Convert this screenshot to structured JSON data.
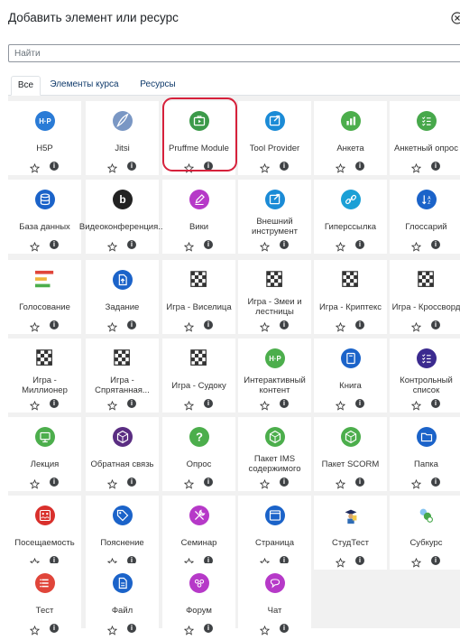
{
  "dialog": {
    "title": "Добавить элемент или ресурс",
    "search_placeholder": "Найти"
  },
  "tabs": [
    {
      "label": "Все",
      "active": true
    },
    {
      "label": "Элементы курса",
      "active": false
    },
    {
      "label": "Ресурсы",
      "active": false
    }
  ],
  "modules": [
    {
      "name": "H5P",
      "icon": "h5p-icon",
      "color": "#2a7bd6"
    },
    {
      "name": "Jitsi",
      "icon": "feather-icon",
      "color": "#7a97c4"
    },
    {
      "name": "Pruffme Module",
      "icon": "briefcase-play-icon",
      "color": "#3c9a4a",
      "highlighted": true
    },
    {
      "name": "Tool Provider",
      "icon": "external-tool-icon",
      "color": "#1b8bd6"
    },
    {
      "name": "Анкета",
      "icon": "chart-icon",
      "color": "#4cae4c"
    },
    {
      "name": "Анкетный опрос",
      "icon": "checklist-icon",
      "color": "#47a84b"
    },
    {
      "name": "База данных",
      "icon": "database-icon",
      "color": "#1b63c9"
    },
    {
      "name": "Видеоконференция...",
      "icon": "b-logo-icon",
      "color": "#222222"
    },
    {
      "name": "Вики",
      "icon": "pencil-icon",
      "color": "#b639c8"
    },
    {
      "name": "Внешний инструмент",
      "icon": "external-tool-icon",
      "color": "#1b8bd6"
    },
    {
      "name": "Гиперссылка",
      "icon": "link-icon",
      "color": "#1ba0d6"
    },
    {
      "name": "Глоссарий",
      "icon": "sort-icon",
      "color": "#1b63c9"
    },
    {
      "name": "Голосование",
      "icon": "bars-icon",
      "color": "#e0453a"
    },
    {
      "name": "Задание",
      "icon": "upload-icon",
      "color": "#1b63c9"
    },
    {
      "name": "Игра - Виселица",
      "icon": "checker-icon",
      "color": "#333333"
    },
    {
      "name": "Игра - Змеи и лестницы",
      "icon": "checker-icon",
      "color": "#333333"
    },
    {
      "name": "Игра - Криптекс",
      "icon": "checker-icon",
      "color": "#333333"
    },
    {
      "name": "Игра - Кроссворд",
      "icon": "checker-icon",
      "color": "#333333"
    },
    {
      "name": "Игра - Миллионер",
      "icon": "checker-icon",
      "color": "#333333"
    },
    {
      "name": "Игра - Спрятанная...",
      "icon": "checker-icon",
      "color": "#333333"
    },
    {
      "name": "Игра - Судоку",
      "icon": "checker-icon",
      "color": "#333333"
    },
    {
      "name": "Интерактивный контент",
      "icon": "h5p-icon",
      "color": "#4cae4c"
    },
    {
      "name": "Книга",
      "icon": "book-icon",
      "color": "#1b63c9"
    },
    {
      "name": "Контрольный список",
      "icon": "checklist-icon",
      "color": "#3b2a8f"
    },
    {
      "name": "Лекция",
      "icon": "lesson-icon",
      "color": "#4cae4c"
    },
    {
      "name": "Обратная связь",
      "icon": "feedback-icon",
      "color": "#5a2d82"
    },
    {
      "name": "Опрос",
      "icon": "question-icon",
      "color": "#4cae4c"
    },
    {
      "name": "Пакет IMS содержимого",
      "icon": "package-icon",
      "color": "#4cae4c"
    },
    {
      "name": "Пакет SCORM",
      "icon": "package-icon",
      "color": "#4cae4c"
    },
    {
      "name": "Папка",
      "icon": "folder-icon",
      "color": "#1b63c9"
    },
    {
      "name": "Посещаемость",
      "icon": "attendance-icon",
      "color": "#d9302c"
    },
    {
      "name": "Пояснение",
      "icon": "tag-icon",
      "color": "#1b63c9"
    },
    {
      "name": "Семинар",
      "icon": "tools-icon",
      "color": "#b639c8"
    },
    {
      "name": "Страница",
      "icon": "page-icon",
      "color": "#1b63c9"
    },
    {
      "name": "СтудТест",
      "icon": "student-icon",
      "color": "#3b6db0"
    },
    {
      "name": "Субкурс",
      "icon": "subcourse-icon",
      "color": "#47a84b"
    },
    {
      "name": "Тест",
      "icon": "quiz-icon",
      "color": "#e0453a"
    },
    {
      "name": "Файл",
      "icon": "file-icon",
      "color": "#1b63c9"
    },
    {
      "name": "Форум",
      "icon": "forum-icon",
      "color": "#b639c8"
    },
    {
      "name": "Чат",
      "icon": "chat-icon",
      "color": "#b639c8"
    }
  ],
  "controls": {
    "info_glyph": "i"
  }
}
